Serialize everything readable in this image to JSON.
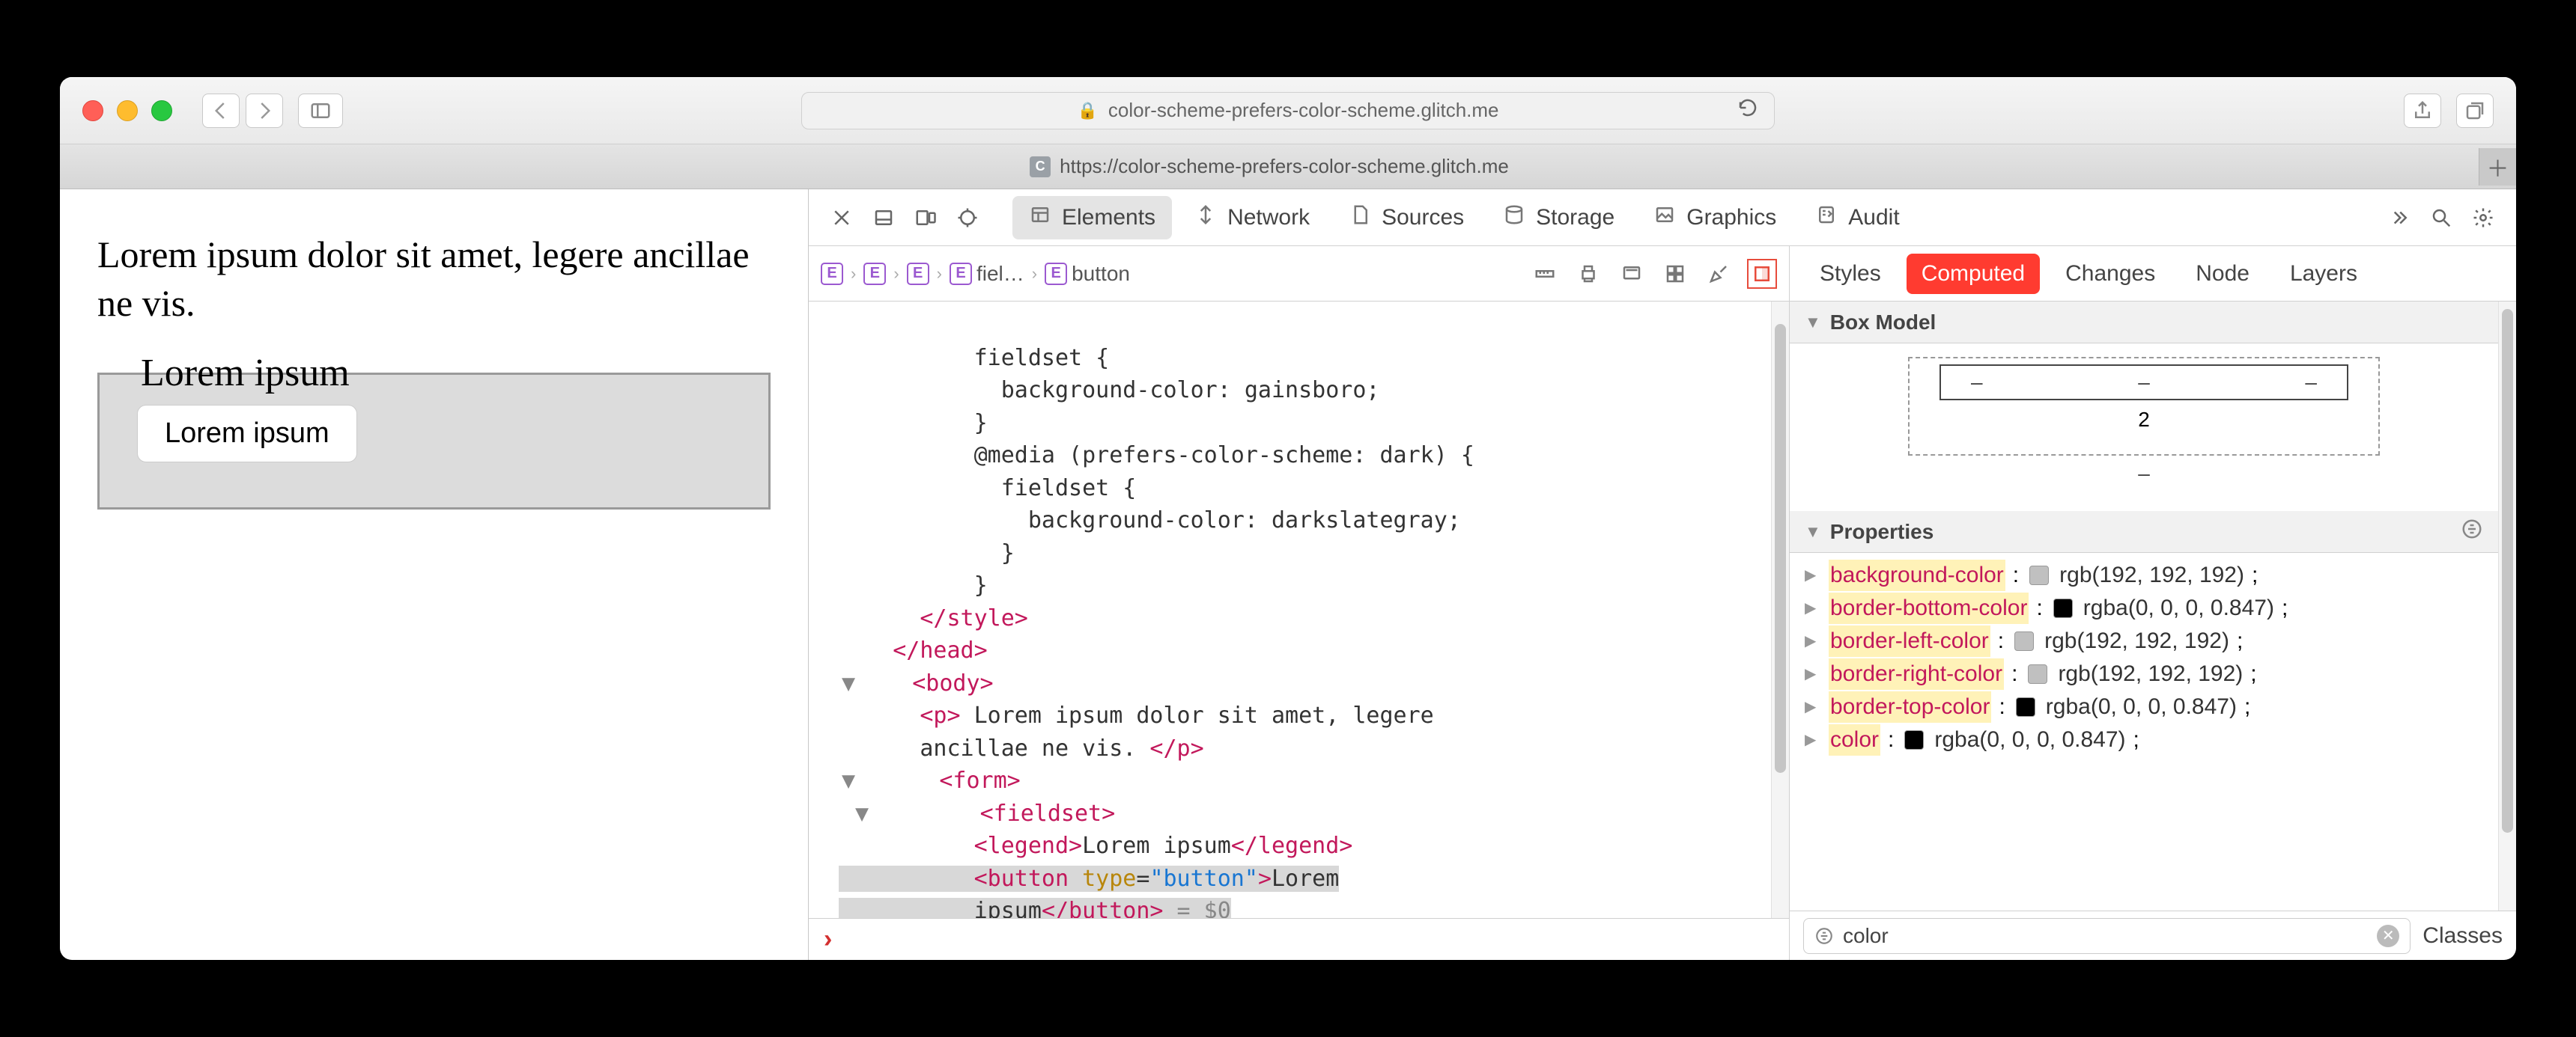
{
  "browser": {
    "url_display": "color-scheme-prefers-color-scheme.glitch.me",
    "tab_url": "https://color-scheme-prefers-color-scheme.glitch.me",
    "tab_favicon_letter": "C"
  },
  "page": {
    "paragraph": "Lorem ipsum dolor sit amet, legere ancillae ne vis.",
    "legend": "Lorem ipsum",
    "button": "Lorem ipsum"
  },
  "devtools": {
    "tabs": {
      "elements": "Elements",
      "network": "Network",
      "sources": "Sources",
      "storage": "Storage",
      "graphics": "Graphics",
      "audit": "Audit"
    },
    "breadcrumb": {
      "b3_label": "fiel…",
      "b4_label": "button"
    },
    "code_lines": {
      "l1": "          fieldset {",
      "l2": "            background-color: gainsboro;",
      "l3": "          }",
      "l4": "          @media (prefers-color-scheme: dark) {",
      "l5": "            fieldset {",
      "l6": "              background-color: darkslategray;",
      "l7": "            }",
      "l8": "          }",
      "l9_a": "      ",
      "l9_b": "</style>",
      "l10_a": "    ",
      "l10_b": "</head>",
      "l11_a": "    ",
      "l11_b": "<body>",
      "l12_a": "      ",
      "l12_b": "<p>",
      "l12_c": " Lorem ipsum dolor sit amet, legere",
      "l13_a": "      ancillae ne vis. ",
      "l13_b": "</p>",
      "l14_a": "      ",
      "l14_b": "<form>",
      "l15_a": "        ",
      "l15_b": "<fieldset>",
      "l16_a": "          ",
      "l16_b": "<legend>",
      "l16_c": "Lorem ipsum",
      "l16_d": "</legend>",
      "l17_a": "          ",
      "l17_b": "<button ",
      "l17_c": "type",
      "l17_d": "=",
      "l17_e": "\"button\"",
      "l17_f": ">",
      "l17_g": "Lorem",
      "l18_a": "          ipsum",
      "l18_b": "</button>",
      "l18_c": " = $0"
    },
    "styles_tabs": {
      "styles": "Styles",
      "computed": "Computed",
      "changes": "Changes",
      "node": "Node",
      "layers": "Layers"
    },
    "boxmodel": {
      "title": "Box Model",
      "dash": "–",
      "two": "2"
    },
    "properties": {
      "title": "Properties",
      "rows": [
        {
          "key": "background-color",
          "swatch": "#c0c0c0",
          "val": "rgb(192, 192, 192)"
        },
        {
          "key": "border-bottom-color",
          "swatch": "#000000",
          "val": "rgba(0, 0, 0, 0.847)"
        },
        {
          "key": "border-left-color",
          "swatch": "#c0c0c0",
          "val": "rgb(192, 192, 192)"
        },
        {
          "key": "border-right-color",
          "swatch": "#c0c0c0",
          "val": "rgb(192, 192, 192)"
        },
        {
          "key": "border-top-color",
          "swatch": "#000000",
          "val": "rgba(0, 0, 0, 0.847)"
        },
        {
          "key": "color",
          "swatch": "#000000",
          "val": "rgba(0, 0, 0, 0.847)"
        }
      ]
    },
    "filter": {
      "value": "color",
      "classes": "Classes"
    }
  }
}
